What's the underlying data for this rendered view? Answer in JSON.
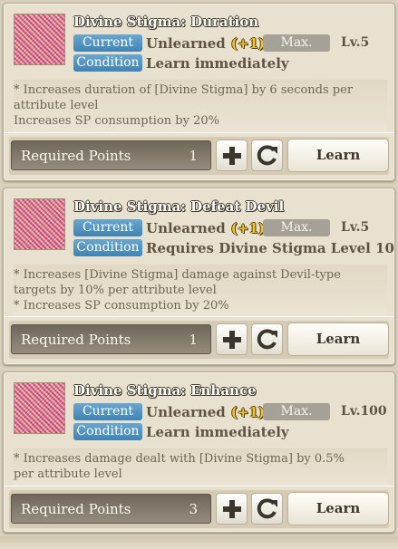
{
  "cards": [
    {
      "title": "Divine Stigma: Duration",
      "current_tag": "Current",
      "current_value": "Unlearned",
      "current_bonus": "(+1)",
      "max_tag": "Max.",
      "max_level": "Lv.5",
      "condition_tag": "Condition",
      "condition_value": "Learn immediately",
      "desc_lines": [
        "* Increases duration of [Divine Stigma] by 6 seconds per",
        "attribute level",
        "Increases SP consumption by 20%"
      ],
      "required_label": "Required Points",
      "required_value": "1",
      "learn_label": "Learn"
    },
    {
      "title": "Divine Stigma: Defeat Devil",
      "current_tag": "Current",
      "current_value": "Unlearned",
      "current_bonus": "(+1)",
      "max_tag": "Max.",
      "max_level": "Lv.5",
      "condition_tag": "Condition",
      "condition_value": "Requires Divine Stigma Level 10",
      "desc_lines": [
        "* Increases [Divine Stigma] damage against Devil-type",
        "targets by 10% per attribute level",
        "* Increases SP consumption by 20%"
      ],
      "required_label": "Required Points",
      "required_value": "1",
      "learn_label": "Learn"
    },
    {
      "title": "Divine Stigma: Enhance",
      "current_tag": "Current",
      "current_value": "Unlearned",
      "current_bonus": "(+1)",
      "max_tag": "Max.",
      "max_level": "Lv.100",
      "condition_tag": "Condition",
      "condition_value": "Learn immediately",
      "desc_lines": [
        "* Increases damage dealt with [Divine Stigma] by 0.5%",
        "per attribute level"
      ],
      "required_label": "Required Points",
      "required_value": "3",
      "learn_label": "Learn"
    }
  ],
  "icons": {
    "plus": "plus-icon",
    "reset": "reset-icon"
  },
  "colors": {
    "tag_blue": "#4a8fc0",
    "bonus_gold": "#f3c52a",
    "panel": "#e9e1cf"
  }
}
